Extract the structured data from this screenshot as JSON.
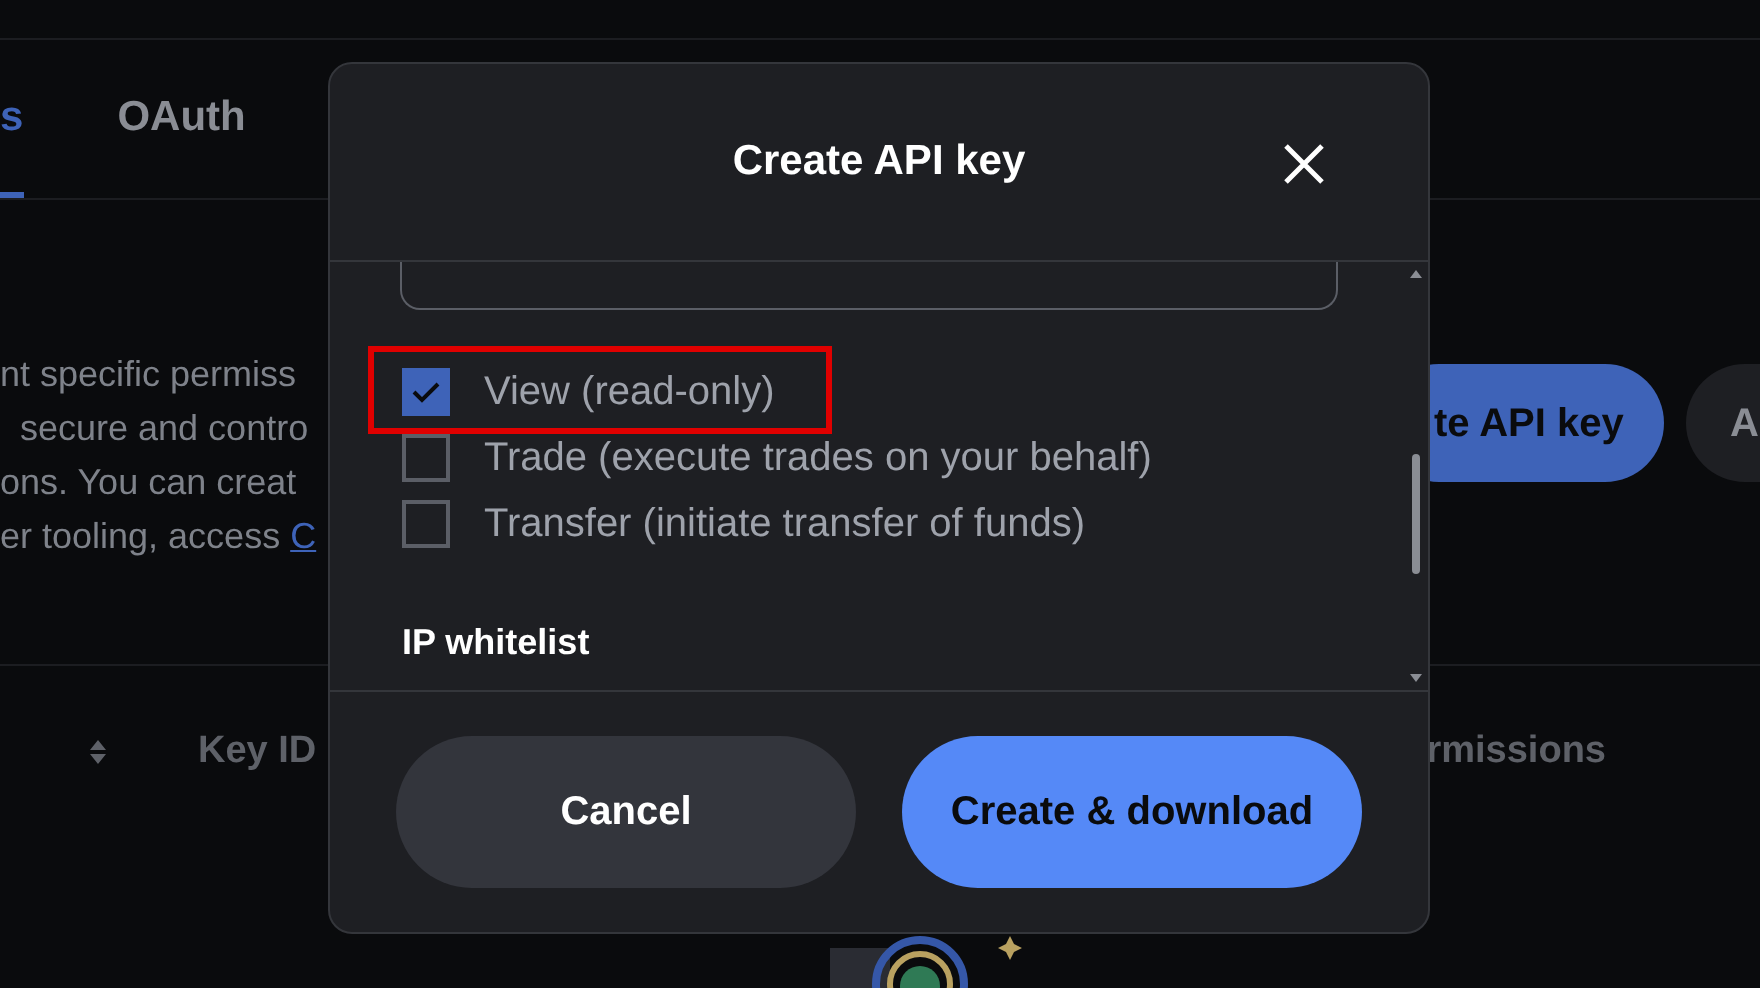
{
  "page": {
    "tabs": [
      {
        "label": "s",
        "selected": true
      },
      {
        "label": "OAuth",
        "selected": false
      }
    ],
    "description": {
      "lines": [
        "nt specific permiss",
        "secure and contro",
        "ons. You can creat",
        "er tooling, access"
      ],
      "link": "C"
    },
    "buttons": [
      "te API key",
      "A"
    ],
    "table": {
      "columns": [
        "Key ID",
        "rmissions"
      ]
    }
  },
  "dialog": {
    "title": "Create API key",
    "permissions": [
      {
        "label": "View (read-only)",
        "checked": true,
        "highlighted": true
      },
      {
        "label": "Trade (execute trades on your behalf)",
        "checked": false,
        "highlighted": false
      },
      {
        "label": "Transfer (initiate transfer of funds)",
        "checked": false,
        "highlighted": false
      }
    ],
    "section": "IP whitelist",
    "buttons": {
      "cancel": "Cancel",
      "confirm": "Create & download"
    }
  }
}
